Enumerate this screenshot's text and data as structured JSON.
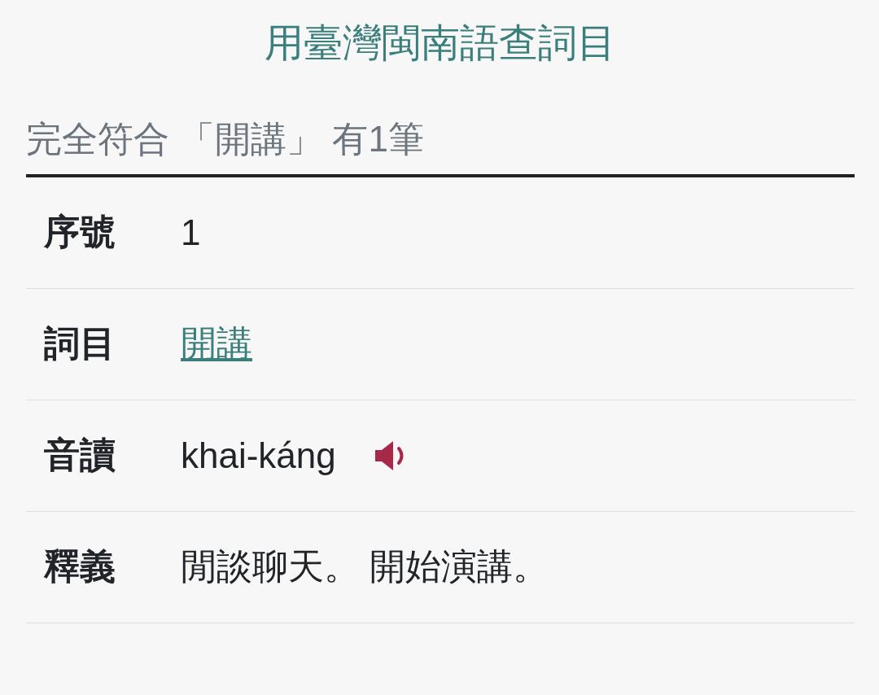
{
  "title": "用臺灣閩南語查詞目",
  "result_summary": "完全符合 「開講」 有1筆",
  "rows": [
    {
      "label": "序號",
      "value": "1",
      "kind": "text"
    },
    {
      "label": "詞目",
      "value": "開講",
      "kind": "link"
    },
    {
      "label": "音讀",
      "value": "khai-káng",
      "kind": "audio"
    },
    {
      "label": "釋義",
      "value": "閒談聊天。 開始演講。",
      "kind": "text"
    }
  ]
}
